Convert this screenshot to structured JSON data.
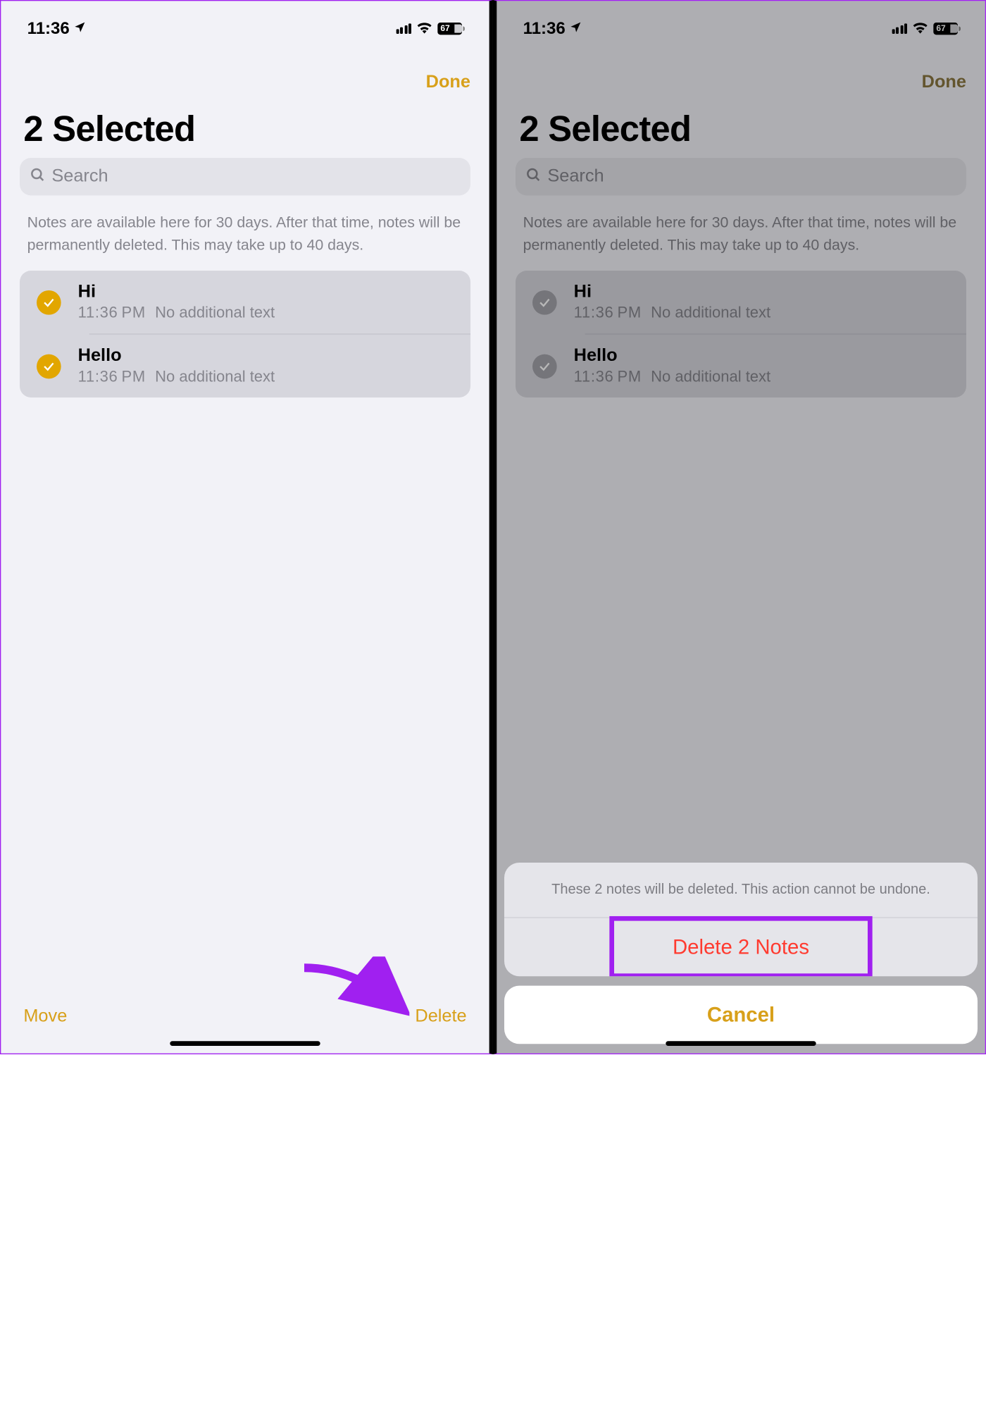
{
  "status": {
    "time": "11:36",
    "battery": "67"
  },
  "nav": {
    "done": "Done"
  },
  "title": "2 Selected",
  "search": {
    "placeholder": "Search"
  },
  "info": "Notes are available here for 30 days. After that time, notes will be permanently deleted. This may take up to 40 days.",
  "notes": [
    {
      "title": "Hi",
      "time": "11:36 PM",
      "sub": "No additional text"
    },
    {
      "title": "Hello",
      "time": "11:36 PM",
      "sub": "No additional text"
    }
  ],
  "bottom": {
    "move": "Move",
    "delete": "Delete"
  },
  "sheet": {
    "message": "These 2 notes will be deleted. This action cannot be undone.",
    "action": "Delete 2 Notes",
    "cancel": "Cancel"
  }
}
